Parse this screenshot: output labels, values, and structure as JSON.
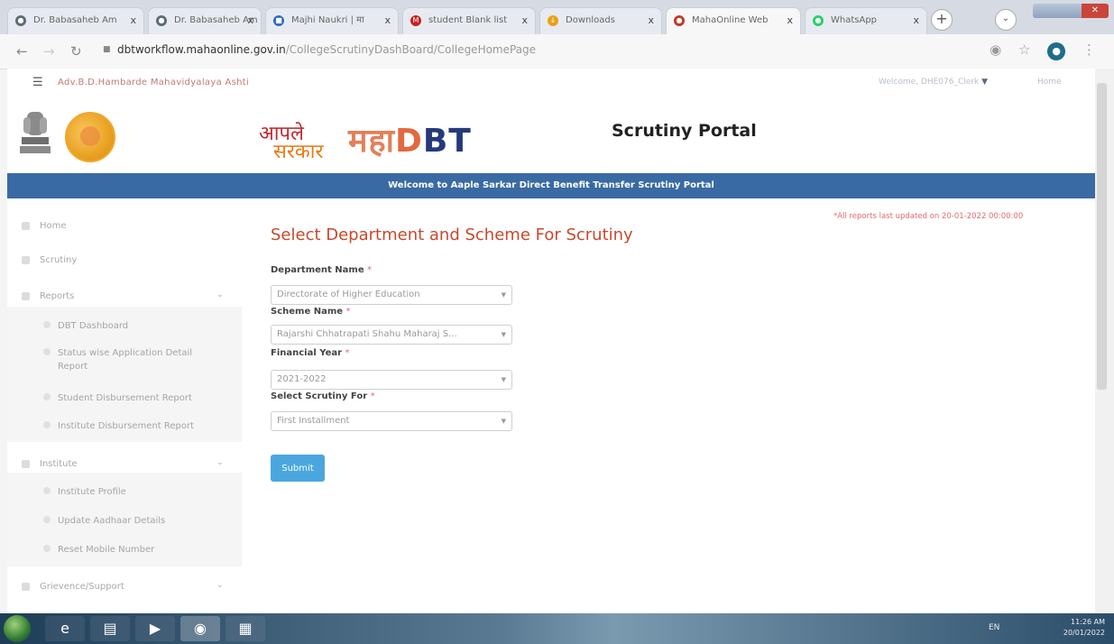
{
  "browser": {
    "tabs": [
      {
        "title": "Dr. Babasaheb Am",
        "fav_color": "#5f6b78"
      },
      {
        "title": "Dr. Babasaheb Am",
        "fav_color": "#5f6b78"
      },
      {
        "title": "Majhi Naukri | मा",
        "fav_color": "#2d6cc0"
      },
      {
        "title": "student Blank list",
        "fav_color": "#c5221f"
      },
      {
        "title": "Downloads",
        "fav_color": "#e8a317"
      },
      {
        "title": "MahaOnline Web",
        "fav_color": "#c0392b"
      },
      {
        "title": "WhatsApp",
        "fav_color": "#25d366"
      }
    ],
    "close_glyph": "x",
    "url_host": "dbtworkflow.mahaonline.gov.in",
    "url_path": "/CollegeScrutinyDashBoard/CollegeHomePage"
  },
  "site": {
    "college_name": "Adv.B.D.Hambarde Mahavidyalaya Ashti",
    "welcome_text": "Welcome, DHE076_Clerk",
    "home_link": "Home",
    "logo_aaple_1": "आपले",
    "logo_aaple_2": "सरकार",
    "logo_maha": "महा",
    "logo_dbt_d": "D",
    "logo_dbt_bt": "BT",
    "portal_title": "Scrutiny Portal",
    "bluebar_text": "Welcome to Aaple Sarkar Direct Benefit Transfer Scrutiny Portal"
  },
  "sidebar": {
    "items": [
      {
        "label": "Home"
      },
      {
        "label": "Scrutiny"
      },
      {
        "label": "Reports"
      },
      {
        "label": "Institute"
      },
      {
        "label": "Grievence/Support"
      }
    ],
    "reports_sub": [
      {
        "label": "DBT Dashboard"
      },
      {
        "label": "Status wise Application Detail Report"
      },
      {
        "label": "Student Disbursement Report"
      },
      {
        "label": "Institute Disbursement Report"
      }
    ],
    "institute_sub": [
      {
        "label": "Institute Profile"
      },
      {
        "label": "Update Aadhaar Details"
      },
      {
        "label": "Reset Mobile Number"
      }
    ]
  },
  "main": {
    "heading": "Select Department and Scheme For Scrutiny",
    "notice": "*All reports last updated on 20-01-2022 00:00:00",
    "fields": {
      "department_label": "Department Name",
      "department_value": "Directorate of Higher Education",
      "scheme_label": "Scheme Name",
      "scheme_value": "Rajarshi Chhatrapati Shahu Maharaj S...",
      "year_label": "Financial Year",
      "year_value": "2021-2022",
      "scrutiny_label": "Select Scrutiny For",
      "scrutiny_value": "First Installment"
    },
    "required_mark": "*",
    "submit_label": "Submit"
  },
  "taskbar": {
    "lang": "EN",
    "time": "11:26 AM",
    "date": "20/01/2022"
  }
}
